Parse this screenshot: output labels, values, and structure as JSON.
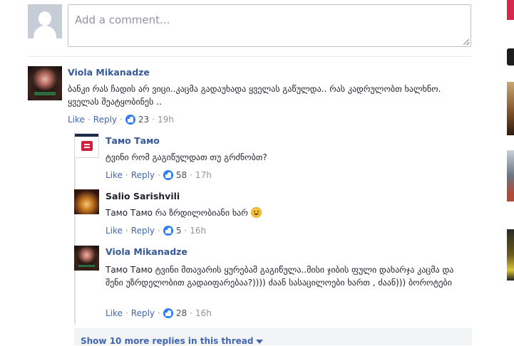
{
  "composer": {
    "placeholder": "Add a comment..."
  },
  "comment": {
    "author": "Viola Mikanadze",
    "text": "ბანკი რას ჩადის არ ვიცი..კაცმა გადაუხადა ყველას გაწულდა.. რას კადრულობთ ხალხნო. ყველას შეატყობინეს ..",
    "like": "Like",
    "reply": "Reply",
    "likes": "23",
    "time": "19h"
  },
  "replies": [
    {
      "author": "Tамо Tамо",
      "text": "ტვინი რომ გაგიწულდათ თუ გრძნობთ?",
      "like": "Like",
      "reply": "Reply",
      "likes": "58",
      "time": "17h"
    },
    {
      "author": "Salio Sarishvili",
      "text": "Tамо Tамо რა ზრდილობიანი ხარ",
      "like": "Like",
      "reply": "Reply",
      "likes": "5",
      "time": "16h"
    },
    {
      "author": "Viola Mikanadze",
      "text": "Tамо Tамо ტვინი მთავარის ყურებამ გაგიწულა..მისი ჯიბის ფული დახარჯა კაცმა და შენი უზრდელობით გადაიფარებაა?)))) ძაან სასაცილოები ხართ , ძაან))) ბოროტები",
      "like": "Like",
      "reply": "Reply",
      "likes": "28",
      "time": "16h"
    }
  ],
  "more_replies": "Show 10 more replies in this thread"
}
